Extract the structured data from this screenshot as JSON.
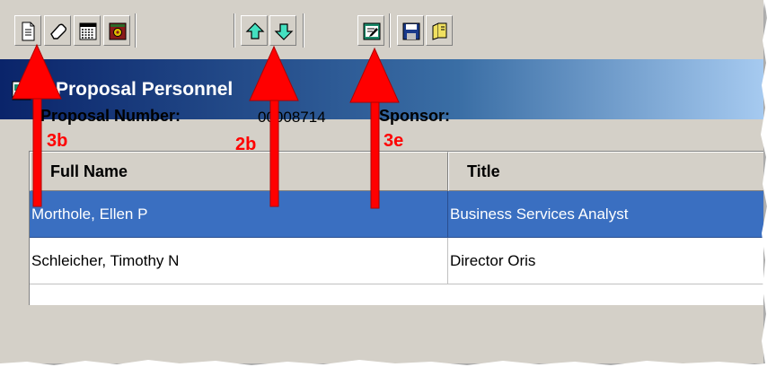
{
  "toolbar": {
    "buttons": [
      {
        "name": "new-document-icon"
      },
      {
        "name": "eraser-icon"
      },
      {
        "name": "grid-icon"
      },
      {
        "name": "sponsor-tool-icon"
      },
      {
        "name": "arrow-up-icon"
      },
      {
        "name": "arrow-down-icon"
      },
      {
        "name": "edit-notes-icon"
      },
      {
        "name": "save-icon"
      },
      {
        "name": "open-folder-icon"
      }
    ]
  },
  "window": {
    "title": "Proposal Personnel",
    "proposal_number_label": "Proposal Number:",
    "proposal_number_value": "00008714",
    "sponsor_label": "Sponsor:"
  },
  "table": {
    "columns": [
      "Full Name",
      "Title"
    ],
    "rows": [
      {
        "full_name": "Morthole, Ellen P",
        "title": "Business Services Analyst",
        "selected": true
      },
      {
        "full_name": "Schleicher, Timothy N",
        "title": "Director Oris",
        "selected": false
      }
    ]
  },
  "annotations": {
    "labels": [
      "3b",
      "2b",
      "3e"
    ],
    "color": "#ff0000"
  },
  "colors": {
    "titlebar_start": "#0a246a",
    "selection": "#3a6fc1",
    "face": "#d4d0c8"
  }
}
